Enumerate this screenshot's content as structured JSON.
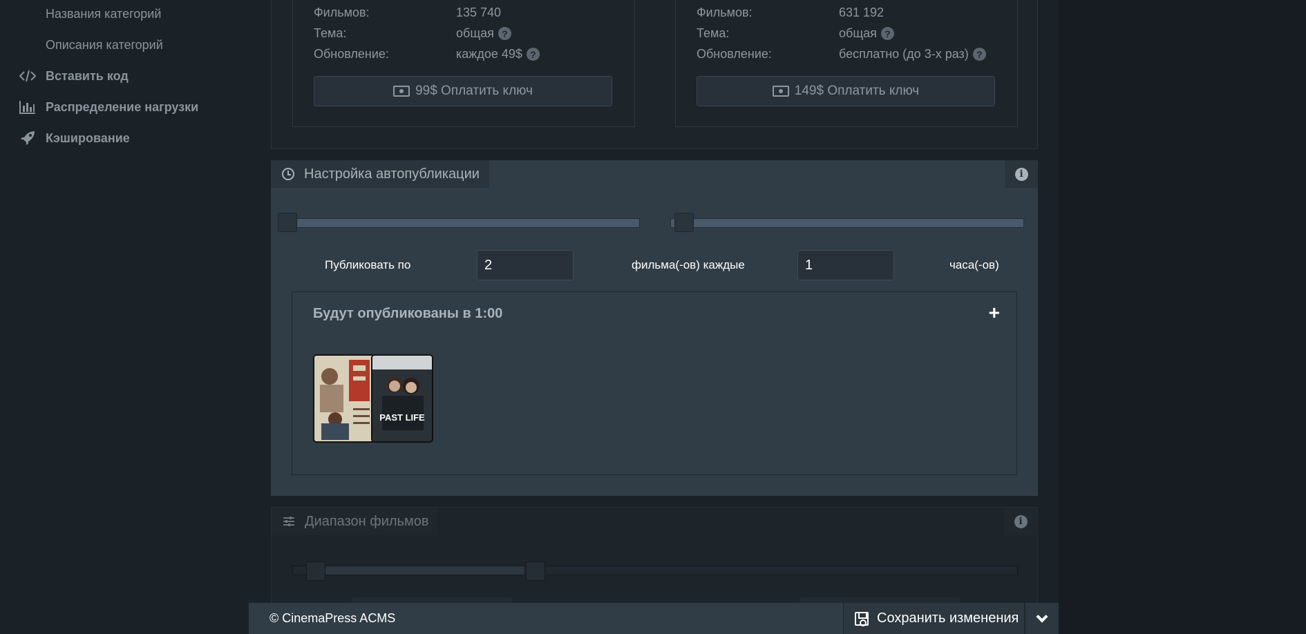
{
  "sidebar": {
    "sub_items": [
      "Названия категорий",
      "Описания категорий"
    ],
    "items": [
      {
        "label": "Вставить код",
        "icon": "code-icon"
      },
      {
        "label": "Распределение нагрузки",
        "icon": "bar-chart-icon"
      },
      {
        "label": "Кэширование",
        "icon": "rocket-icon"
      }
    ]
  },
  "plans": [
    {
      "films_label": "Фильмов:",
      "films_value": "135 740",
      "theme_label": "Тема:",
      "theme_value": "общая",
      "update_label": "Обновление:",
      "update_value": "каждое 49$",
      "pay_button": "99$ Оплатить ключ"
    },
    {
      "films_label": "Фильмов:",
      "films_value": "631 192",
      "theme_label": "Тема:",
      "theme_value": "общая",
      "update_label": "Обновление:",
      "update_value": "бесплатно (до 3-х раз)",
      "pay_button": "149$ Оплатить ключ"
    }
  ],
  "autopublish": {
    "title": "Настройка автопубликации",
    "slider_films": 0,
    "slider_hours": 0,
    "publish_label": "Публиковать по",
    "films_value": "2",
    "films_every_label": "фильма(-ов) каждые",
    "hours_value": "1",
    "hours_label": "часа(-ов)",
    "scheduled_title": "Будут опубликованы в 1:00",
    "plus": "+",
    "posters": [
      {
        "name": "poster-1",
        "colors": [
          "#d8cfb8",
          "#b23a2a",
          "#6a4a3a"
        ]
      },
      {
        "name": "poster-2",
        "colors": [
          "#222a30",
          "#4a545c",
          "#ffffff"
        ],
        "text": "PAST LIFE"
      }
    ]
  },
  "range": {
    "title": "Диапазон фильмов"
  },
  "footer": {
    "copyright": "© CinemaPress ACMS",
    "save_label": "Сохранить изменения"
  },
  "colors": {
    "accent_panel": "#313d46",
    "background": "#1b2227"
  }
}
